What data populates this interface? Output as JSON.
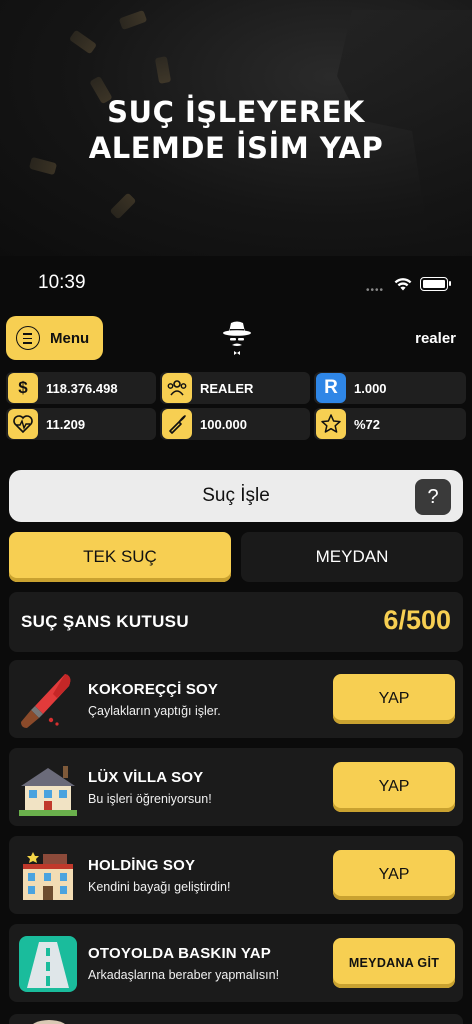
{
  "promo": {
    "title_line1": "SUÇ İŞLEYEREK",
    "title_line2": "ALEMDE İSİM YAP"
  },
  "status_bar": {
    "time": "10:39",
    "signal": "••••",
    "icons": [
      "wifi-icon",
      "battery-icon"
    ]
  },
  "topbar": {
    "menu_label": "Menu",
    "menu_icon": "hamburger-icon",
    "logo_icon": "gangster-hat-icon",
    "username": "realer"
  },
  "stats": {
    "money": {
      "icon": "dollar-icon",
      "value": "118.376.498"
    },
    "group": {
      "icon": "group-icon",
      "value": "REALER"
    },
    "rank_points": {
      "icon": "r-badge-icon",
      "badge_text": "R",
      "value": "1.000"
    },
    "health": {
      "icon": "heart-pulse-icon",
      "value": "11.209"
    },
    "ammo": {
      "icon": "bullet-icon",
      "value": "100.000"
    },
    "reputation": {
      "icon": "star-icon",
      "value": "%72"
    }
  },
  "crime_button": {
    "label": "Suç İşle",
    "help": "?"
  },
  "tabs": [
    {
      "label": "TEK SUÇ",
      "active": true
    },
    {
      "label": "MEYDAN",
      "active": false
    }
  ],
  "chance_box": {
    "label": "SUÇ ŞANS KUTUSU",
    "count": "6/500"
  },
  "crimes": [
    {
      "icon": "knife-icon",
      "title": "KOKOREÇÇİ SOY",
      "desc": "Çaylakların yaptığı işler.",
      "action": "YAP"
    },
    {
      "icon": "villa-icon",
      "title": "LÜX VİLLA SOY",
      "desc": "Bu işleri öğreniyorsun!",
      "action": "YAP"
    },
    {
      "icon": "building-icon",
      "title": "HOLDİNG SOY",
      "desc": "Kendini bayağı geliştirdin!",
      "action": "YAP"
    },
    {
      "icon": "highway-icon",
      "title": "OTOYOLDA BASKIN YAP",
      "desc": "Arkadaşlarına beraber yapmalısın!",
      "action": "MEYDANA GİT"
    }
  ],
  "colors": {
    "accent": "#f7cf52",
    "background": "#0b0b0b",
    "card": "#1b1b1b",
    "blue_badge": "#2f86e6"
  }
}
